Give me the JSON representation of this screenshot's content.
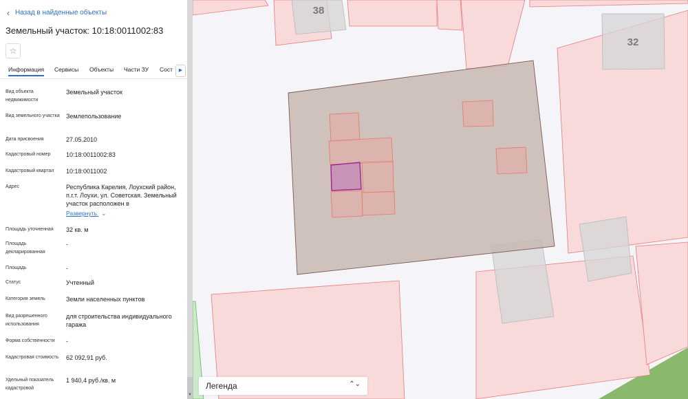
{
  "nav": {
    "back_label": "Назад в найденные объекты"
  },
  "object": {
    "title": "Земельный участок: 10:18:0011002:83"
  },
  "tabs": [
    {
      "label": "Информация"
    },
    {
      "label": "Сервисы"
    },
    {
      "label": "Объекты"
    },
    {
      "label": "Части ЗУ"
    },
    {
      "label": "Сост"
    }
  ],
  "attributes": [
    {
      "label": "Вид объекта недвижимости",
      "value": "Земельный участок"
    },
    {
      "label": "Вид земельного участка",
      "value": "Землепользование"
    },
    {
      "label": "Дата присвоения",
      "value": "27.05.2010"
    },
    {
      "label": "Кадастровый номер",
      "value": "10:18:0011002:83"
    },
    {
      "label": "Кадастровый квартал",
      "value": "10:18:0011002"
    },
    {
      "label": "Адрес",
      "value": "Республика Карелия, Лоухский район, п.г.т. Лоухи, ул. Советская. Земельный участок расположен в"
    },
    {
      "label": "Площадь уточненная",
      "value": "32 кв. м"
    },
    {
      "label": "Площадь декларированная",
      "value": "-"
    },
    {
      "label": "Площадь",
      "value": "-"
    },
    {
      "label": "Статус",
      "value": "Учтенный"
    },
    {
      "label": "Категория земель",
      "value": "Земли населенных пунктов"
    },
    {
      "label": "Вид разрешенного использования",
      "value": "для строительства индивидуального гаража"
    },
    {
      "label": "Форма собственности",
      "value": "-"
    },
    {
      "label": "Кадастровая стоимость",
      "value": "62 092,91 руб."
    },
    {
      "label": "Удельный показатель кадастровой",
      "value": "1 940,4 руб./кв. м"
    }
  ],
  "address_expand": "Развернуть",
  "map": {
    "label_38": "38",
    "label_32": "32"
  },
  "legend": {
    "label": "Легенда"
  },
  "icons": {
    "back": "chevron-left-icon",
    "star": "star-icon",
    "tabs_next": "chevron-right-icon",
    "expand": "chevron-down-icon",
    "legend": "expand-collapse-icon"
  },
  "colors": {
    "accent": "#2a6fc9",
    "selected_parcel": "#a0268e",
    "parcel_fill": "#f8dada",
    "parcel_stroke": "#e87a7a",
    "building": "#c8b7b2",
    "vegetation": "#8ab86c"
  }
}
